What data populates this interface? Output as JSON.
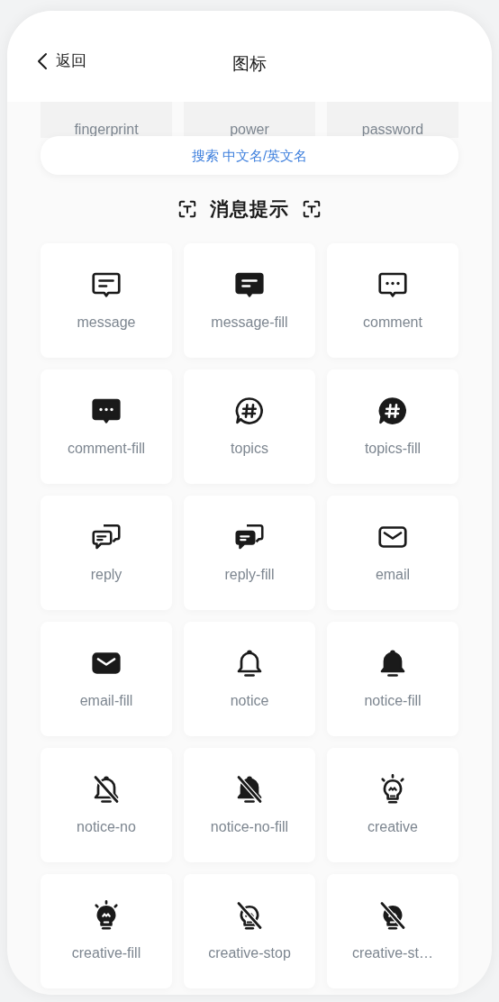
{
  "header": {
    "back": "返回",
    "title": "图标"
  },
  "previous_cards": [
    {
      "label": "fingerprint"
    },
    {
      "label": "power"
    },
    {
      "label": "password"
    }
  ],
  "search": {
    "placeholder": "搜索 中文名/英文名"
  },
  "section": {
    "title": "消息提示"
  },
  "icons": [
    {
      "label": "message"
    },
    {
      "label": "message-fill"
    },
    {
      "label": "comment"
    },
    {
      "label": "comment-fill"
    },
    {
      "label": "topics"
    },
    {
      "label": "topics-fill"
    },
    {
      "label": "reply"
    },
    {
      "label": "reply-fill"
    },
    {
      "label": "email"
    },
    {
      "label": "email-fill"
    },
    {
      "label": "notice"
    },
    {
      "label": "notice-fill"
    },
    {
      "label": "notice-no"
    },
    {
      "label": "notice-no-fill"
    },
    {
      "label": "creative"
    },
    {
      "label": "creative-fill"
    },
    {
      "label": "creative-stop"
    },
    {
      "label": "creative-st…"
    }
  ]
}
